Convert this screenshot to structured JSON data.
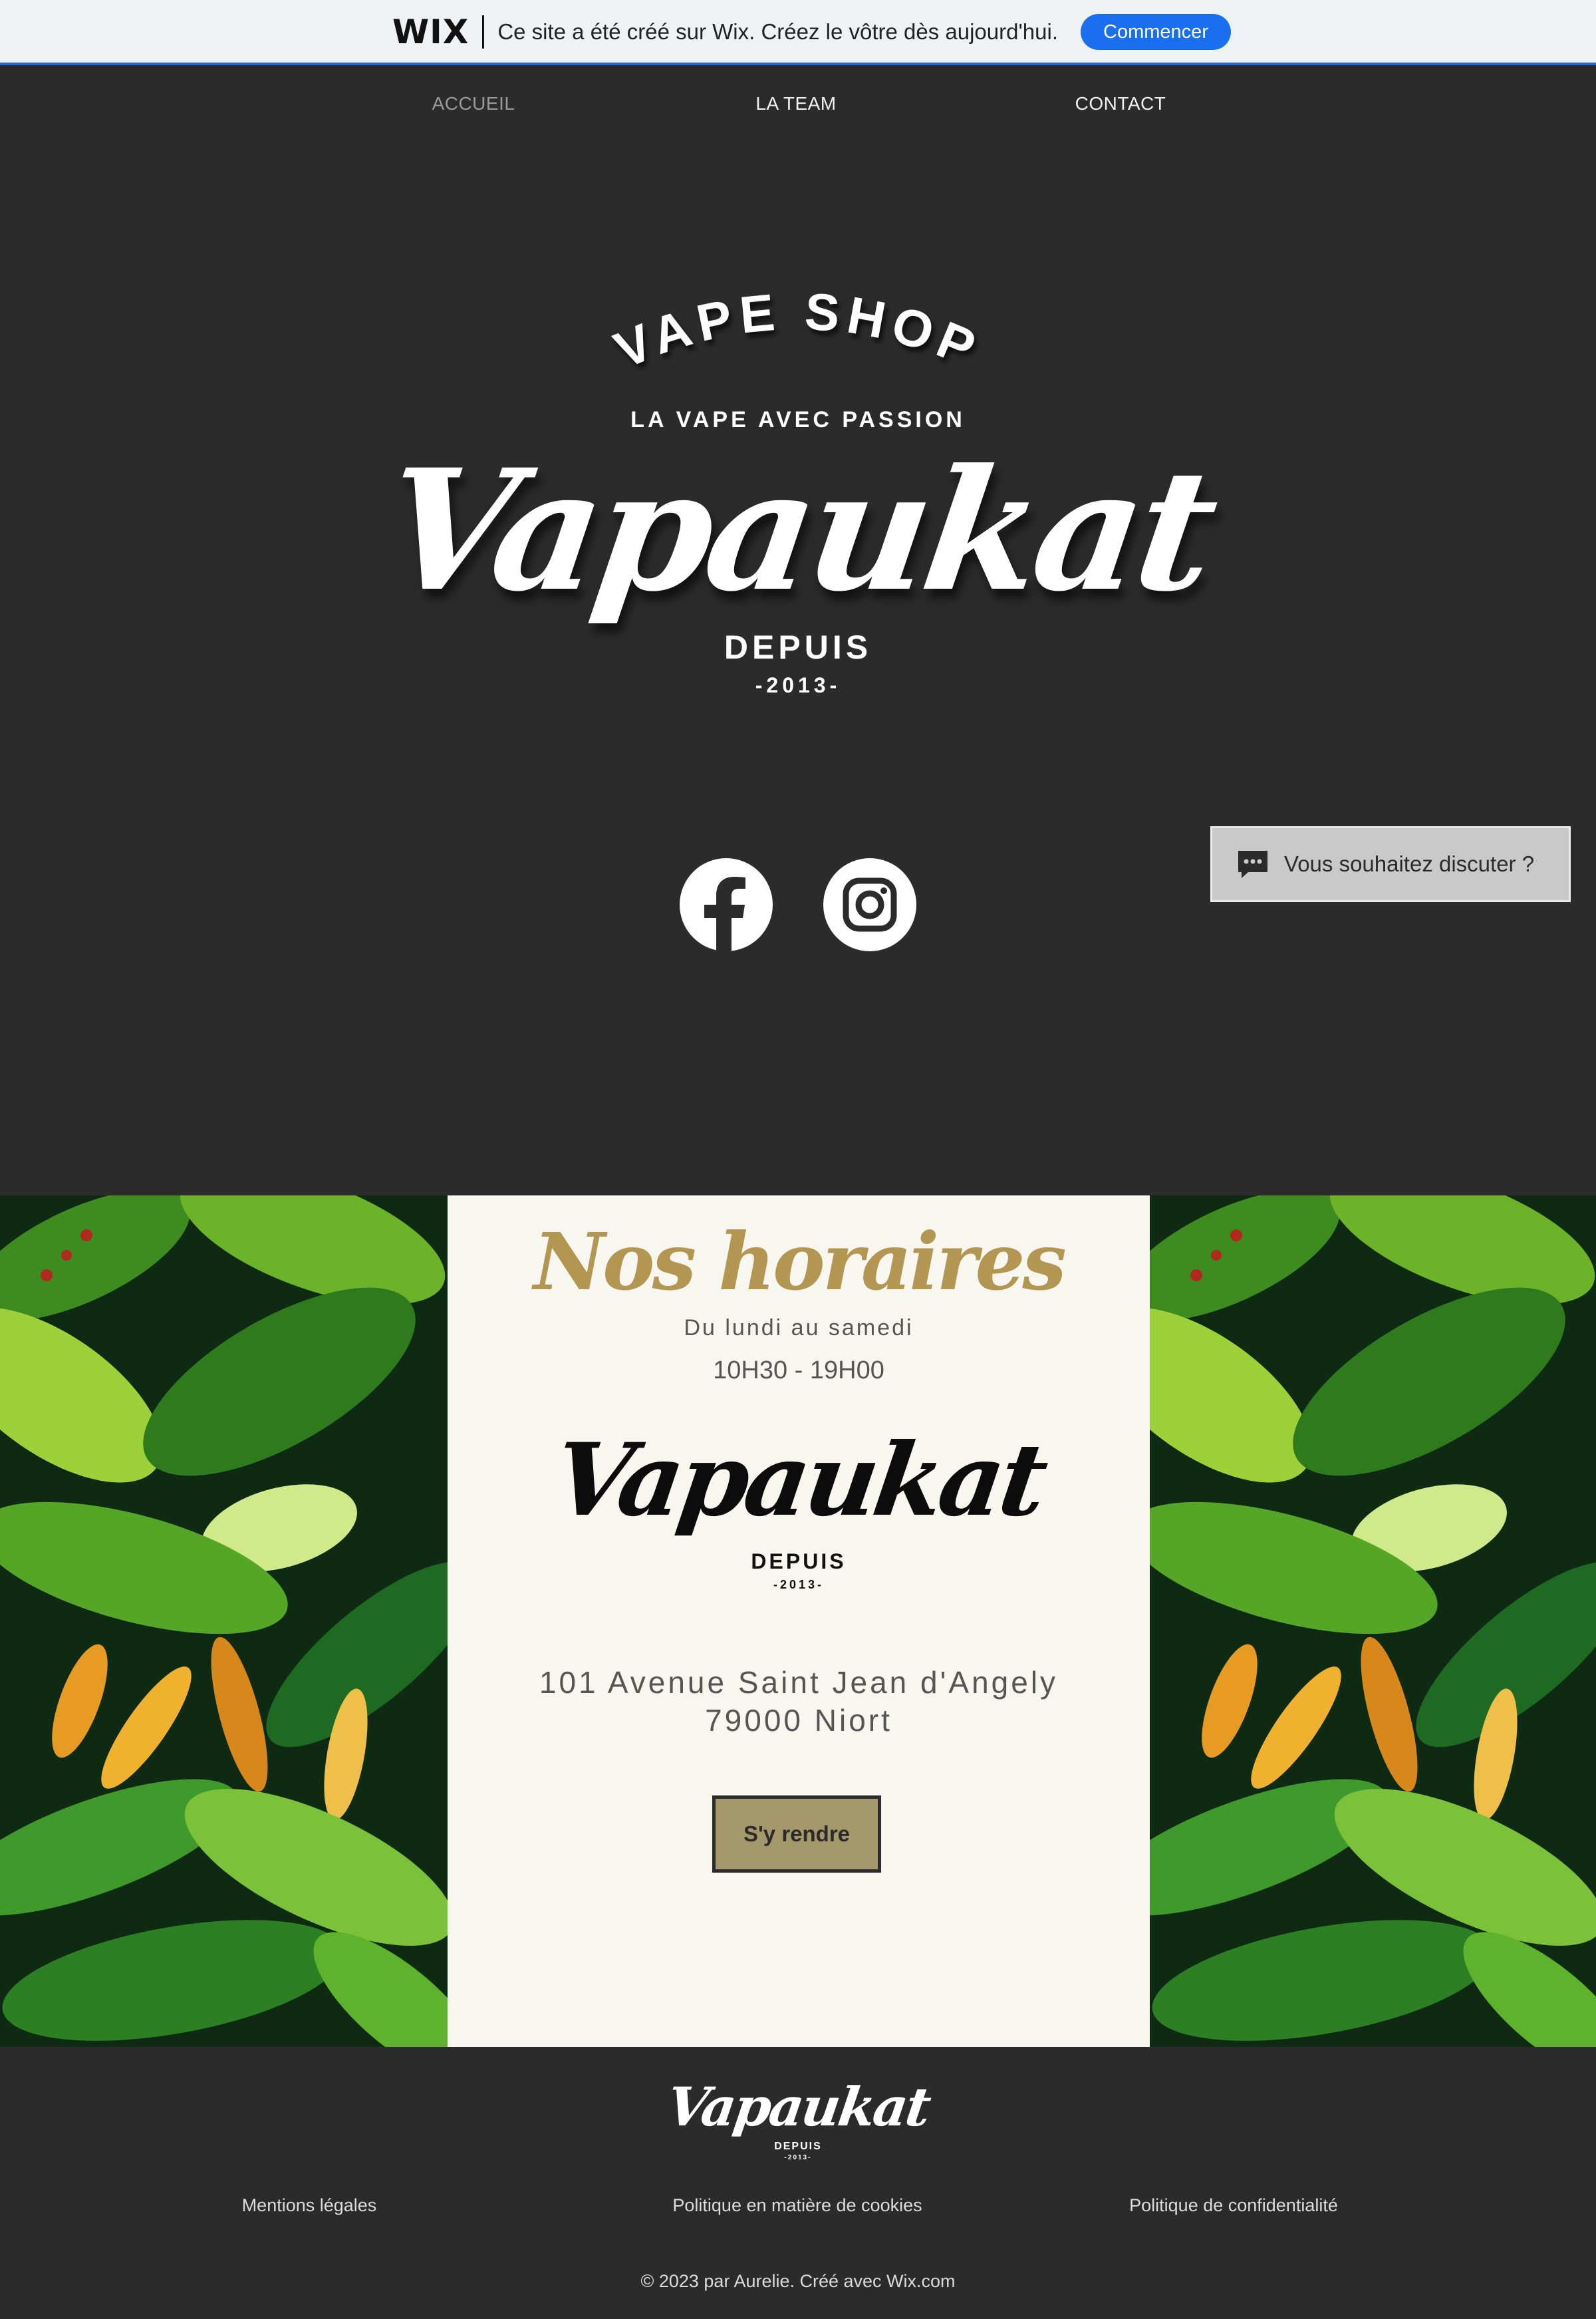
{
  "wix_banner": {
    "logo": "WIX",
    "message": "Ce site a été créé sur Wix. Créez le vôtre dès aujourd'hui.",
    "cta": "Commencer"
  },
  "nav": {
    "items": [
      {
        "label": "ACCUEIL",
        "active": true
      },
      {
        "label": "LA TEAM",
        "active": false
      },
      {
        "label": "CONTACT",
        "active": false
      }
    ]
  },
  "hero": {
    "arc_text": "VAPE SHOP",
    "tagline": "LA VAPE AVEC PASSION",
    "brand": "Vapaukat",
    "since": "DEPUIS",
    "year": "-2013-"
  },
  "social": {
    "icons": [
      "facebook-icon",
      "instagram-icon"
    ]
  },
  "chat": {
    "label": "Vous souhaitez discuter ?",
    "icon": "chat-bubble-icon"
  },
  "hours": {
    "title": "Nos horaires",
    "days": "Du lundi au samedi",
    "time": "10H30 - 19H00",
    "brand": "Vapaukat",
    "since": "DEPUIS",
    "year": "-2013-",
    "address_line1": "101 Avenue Saint Jean d'Angely",
    "address_line2": "79000 Niort",
    "button": "S'y rendre"
  },
  "footer": {
    "brand": "Vapaukat",
    "since": "DEPUIS",
    "year": "-2013-",
    "links": [
      "Mentions légales",
      "Politique en matière de cookies",
      "Politique de confidentialité"
    ],
    "copyright": "© 2023 par Aurelie. Créé avec Wix.com"
  },
  "colors": {
    "background": "#2b2b2b",
    "banner_button": "#1a6ef0",
    "hours_title": "#b39652",
    "panel": "#f8f7ef",
    "button": "#a5986a"
  }
}
